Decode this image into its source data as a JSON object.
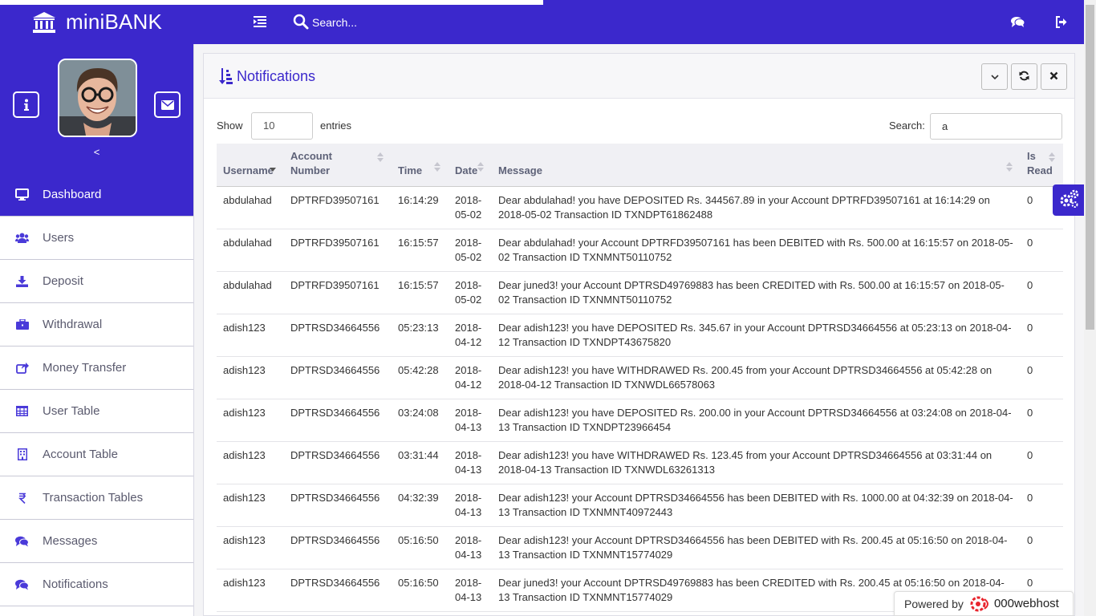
{
  "app": {
    "brand": "miniBANK"
  },
  "topbar": {
    "search_placeholder": "Search..."
  },
  "sidebar": {
    "collapse_label": "<",
    "items": [
      {
        "label": "Dashboard",
        "icon": "desktop-icon",
        "active": true
      },
      {
        "label": "Users",
        "icon": "users-icon"
      },
      {
        "label": "Deposit",
        "icon": "download-icon"
      },
      {
        "label": "Withdrawal",
        "icon": "briefcase-icon"
      },
      {
        "label": "Money Transfer",
        "icon": "share-icon"
      },
      {
        "label": "User Table",
        "icon": "table-icon"
      },
      {
        "label": "Account Table",
        "icon": "building-icon"
      },
      {
        "label": "Transaction Tables",
        "icon": "rupee-icon"
      },
      {
        "label": "Messages",
        "icon": "comments-icon"
      },
      {
        "label": "Notifications",
        "icon": "comments-icon"
      }
    ]
  },
  "panel": {
    "title": "Notifications",
    "show_label": "Show",
    "entries_value": "10",
    "entries_label": "entries",
    "search_label": "Search:",
    "search_value": "a"
  },
  "table": {
    "headers": [
      "Username",
      "Account Number",
      "Time",
      "Date",
      "Message",
      "Is Read"
    ],
    "rows": [
      {
        "username": "abdulahad",
        "account": "DPTRFD39507161",
        "time": "16:14:29",
        "date": "2018-05-02",
        "message": "Dear abdulahad! you have DEPOSITED Rs. 344567.89 in your Account DPTRFD39507161 at 16:14:29 on 2018-05-02 Transaction ID TXNDPT61862488",
        "is_read": "0"
      },
      {
        "username": "abdulahad",
        "account": "DPTRFD39507161",
        "time": "16:15:57",
        "date": "2018-05-02",
        "message": "Dear abdulahad! your Account DPTRFD39507161 has been DEBITED with Rs. 500.00 at 16:15:57 on 2018-05-02 Transaction ID TXNMNT50110752",
        "is_read": "0"
      },
      {
        "username": "abdulahad",
        "account": "DPTRFD39507161",
        "time": "16:15:57",
        "date": "2018-05-02",
        "message": "Dear juned3! your Account DPTRSD49769883 has been CREDITED with Rs. 500.00 at 16:15:57 on 2018-05-02 Transaction ID TXNMNT50110752",
        "is_read": "0"
      },
      {
        "username": "adish123",
        "account": "DPTRSD34664556",
        "time": "05:23:13",
        "date": "2018-04-12",
        "message": "Dear adish123! you have DEPOSITED Rs. 345.67 in your Account DPTRSD34664556 at 05:23:13 on 2018-04-12 Transaction ID TXNDPT43675820",
        "is_read": "0"
      },
      {
        "username": "adish123",
        "account": "DPTRSD34664556",
        "time": "05:42:28",
        "date": "2018-04-12",
        "message": "Dear adish123! you have WITHDRAWED Rs. 200.45 from your Account DPTRSD34664556 at 05:42:28 on 2018-04-12 Transaction ID TXNWDL66578063",
        "is_read": "0"
      },
      {
        "username": "adish123",
        "account": "DPTRSD34664556",
        "time": "03:24:08",
        "date": "2018-04-13",
        "message": "Dear adish123! you have DEPOSITED Rs. 200.00 in your Account DPTRSD34664556 at 03:24:08 on 2018-04-13 Transaction ID TXNDPT23966454",
        "is_read": "0"
      },
      {
        "username": "adish123",
        "account": "DPTRSD34664556",
        "time": "03:31:44",
        "date": "2018-04-13",
        "message": "Dear adish123! you have WITHDRAWED Rs. 123.45 from your Account DPTRSD34664556 at 03:31:44 on 2018-04-13 Transaction ID TXNWDL63261313",
        "is_read": "0"
      },
      {
        "username": "adish123",
        "account": "DPTRSD34664556",
        "time": "04:32:39",
        "date": "2018-04-13",
        "message": "Dear adish123! your Account DPTRSD34664556 has been DEBITED with Rs. 1000.00 at 04:32:39 on 2018-04-13 Transaction ID TXNMNT40972443",
        "is_read": "0"
      },
      {
        "username": "adish123",
        "account": "DPTRSD34664556",
        "time": "05:16:50",
        "date": "2018-04-13",
        "message": "Dear adish123! your Account DPTRSD34664556 has been DEBITED with Rs. 200.45 at 05:16:50 on 2018-04-13 Transaction ID TXNMNT15774029",
        "is_read": "0"
      },
      {
        "username": "adish123",
        "account": "DPTRSD34664556",
        "time": "05:16:50",
        "date": "2018-04-13",
        "message": "Dear juned3! your Account DPTRSD49769883 has been CREDITED with Rs. 200.45 at 05:16:50 on 2018-04-13 Transaction ID TXNMNT15774029",
        "is_read": "0"
      }
    ]
  },
  "footer": {
    "powered_by": "Powered by",
    "host_brand": "000webhost"
  },
  "colors": {
    "primary": "#3b28cc",
    "sidebar_text": "#5a5a6e",
    "powered_logo": "#e8252e"
  }
}
